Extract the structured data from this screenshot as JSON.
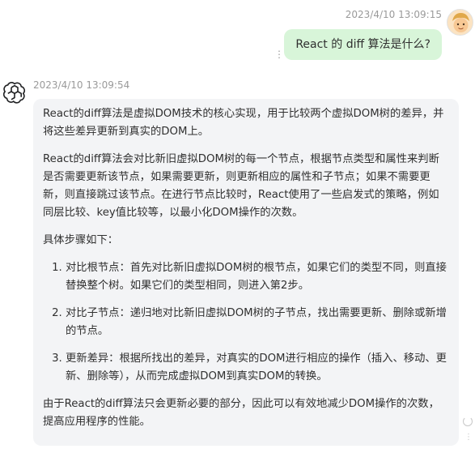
{
  "user_message": {
    "timestamp": "2023/4/10 13:09:15",
    "text": "React 的 diff 算法是什么?",
    "avatar_icon": "emoji-face-avatar",
    "more_icon": "more-vertical-icon"
  },
  "bot_message": {
    "timestamp": "2023/4/10 13:09:54",
    "avatar_icon": "openai-logo",
    "paragraphs": [
      "React的diff算法是虚拟DOM技术的核心实现，用于比较两个虚拟DOM树的差异，并将这些差异更新到真实的DOM上。",
      "React的diff算法会对比新旧虚拟DOM树的每一个节点，根据节点类型和属性来判断是否需要更新该节点，如果需要更新，则更新相应的属性和子节点；如果不需要更新，则直接跳过该节点。在进行节点比较时，React使用了一些启发式的策略，例如同层比较、key值比较等，以最小化DOM操作的次数。",
      "具体步骤如下："
    ],
    "steps": [
      "对比根节点：首先对比新旧虚拟DOM树的根节点，如果它们的类型不同，则直接替换整个树。如果它们的类型相同，则进入第2步。",
      "对比子节点：递归地对比新旧虚拟DOM树的子节点，找出需要更新、删除或新增的节点。",
      "更新差异：根据所找出的差异，对真实的DOM进行相应的操作（插入、移动、更新、删除等），从而完成虚拟DOM到真实DOM的转换。"
    ],
    "conclusion": "由于React的diff算法只会更新必要的部分，因此可以有效地减少DOM操作的次数，提高应用程序的性能。"
  },
  "side_icons": [
    "refresh-icon",
    "more-vertical-icon"
  ]
}
